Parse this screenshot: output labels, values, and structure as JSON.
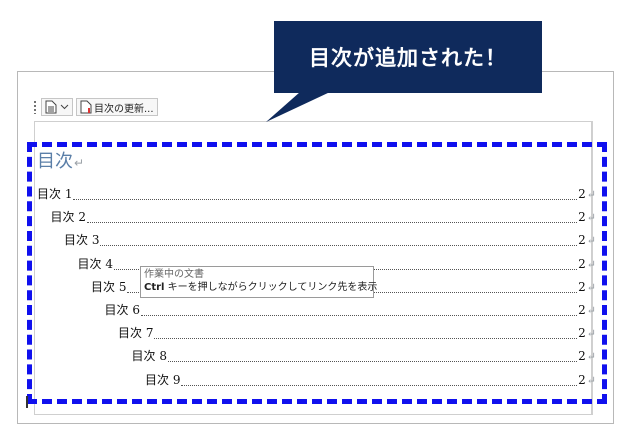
{
  "toolbar": {
    "update_label": "目次の更新..."
  },
  "callout": {
    "text": "目次が追加された！"
  },
  "toc": {
    "heading": "目次",
    "paragraph_mark": "↵",
    "entries": [
      {
        "label": "目次 1",
        "page": "2"
      },
      {
        "label": "目次 2",
        "page": "2"
      },
      {
        "label": "目次 3",
        "page": "2"
      },
      {
        "label": "目次 4",
        "page": "2"
      },
      {
        "label": "目次 5",
        "page": "2"
      },
      {
        "label": "目次 6",
        "page": "2"
      },
      {
        "label": "目次 7",
        "page": "2"
      },
      {
        "label": "目次 8",
        "page": "2"
      },
      {
        "label": "目次 9",
        "page": "2"
      }
    ]
  },
  "tooltip": {
    "title": "作業中の文書",
    "key": "Ctrl",
    "hint": " キーを押しながらクリックしてリンク先を表示"
  },
  "colors": {
    "callout_bg": "#0f2a5c",
    "dash_border": "#1010ee",
    "heading": "#5b7fa8"
  }
}
